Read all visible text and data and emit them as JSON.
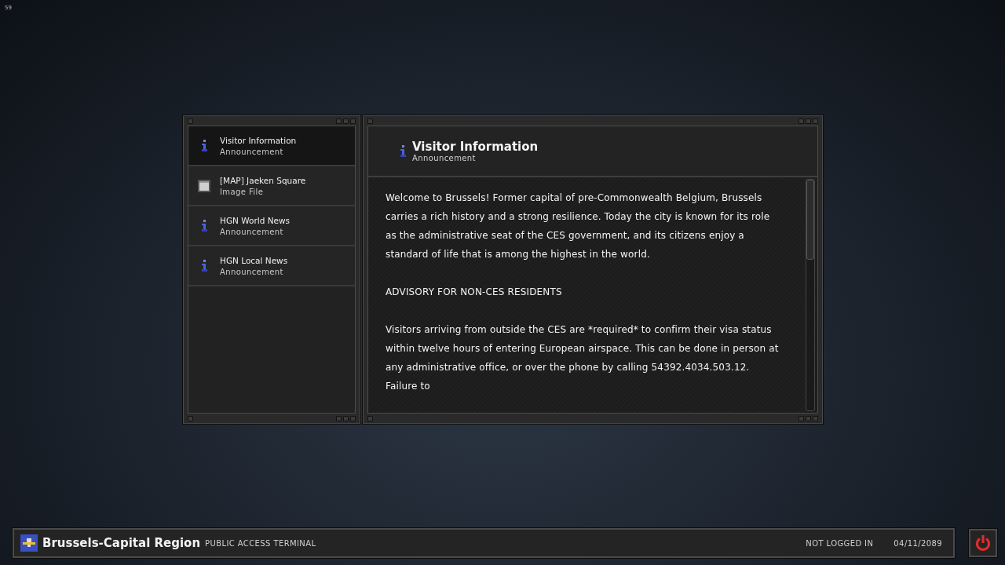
{
  "fps_counter": "59",
  "sidebar": {
    "items": [
      {
        "title": "Visitor Information",
        "subtitle": "Announcement",
        "kind": "announcement",
        "selected": true
      },
      {
        "title": "[MAP] Jaeken Square",
        "subtitle": "Image File",
        "kind": "image",
        "selected": false
      },
      {
        "title": "HGN World News",
        "subtitle": "Announcement",
        "kind": "announcement",
        "selected": false
      },
      {
        "title": "HGN Local News",
        "subtitle": "Announcement",
        "kind": "announcement",
        "selected": false
      }
    ]
  },
  "document": {
    "title": "Visitor Information",
    "subtitle": "Announcement",
    "kind": "announcement",
    "paragraphs": [
      "Welcome to Brussels! Former capital of pre-Commonwealth Belgium, Brussels carries a rich history and a strong resilience. Today the city is known for its role as the administrative seat of the CES government, and its citizens enjoy a standard of life that is among the highest in the world.",
      "ADVISORY FOR NON-CES RESIDENTS",
      "Visitors arriving from outside the CES are *required* to confirm their visa status within twelve hours of entering European airspace. This can be done in person at any administrative office, or over the phone by calling 54392.4034.503.12. Failure to"
    ]
  },
  "status_bar": {
    "region": "Brussels-Capital Region",
    "terminal": "PUBLIC ACCESS TERMINAL",
    "login": "NOT LOGGED IN",
    "date": "04/11/2089"
  }
}
